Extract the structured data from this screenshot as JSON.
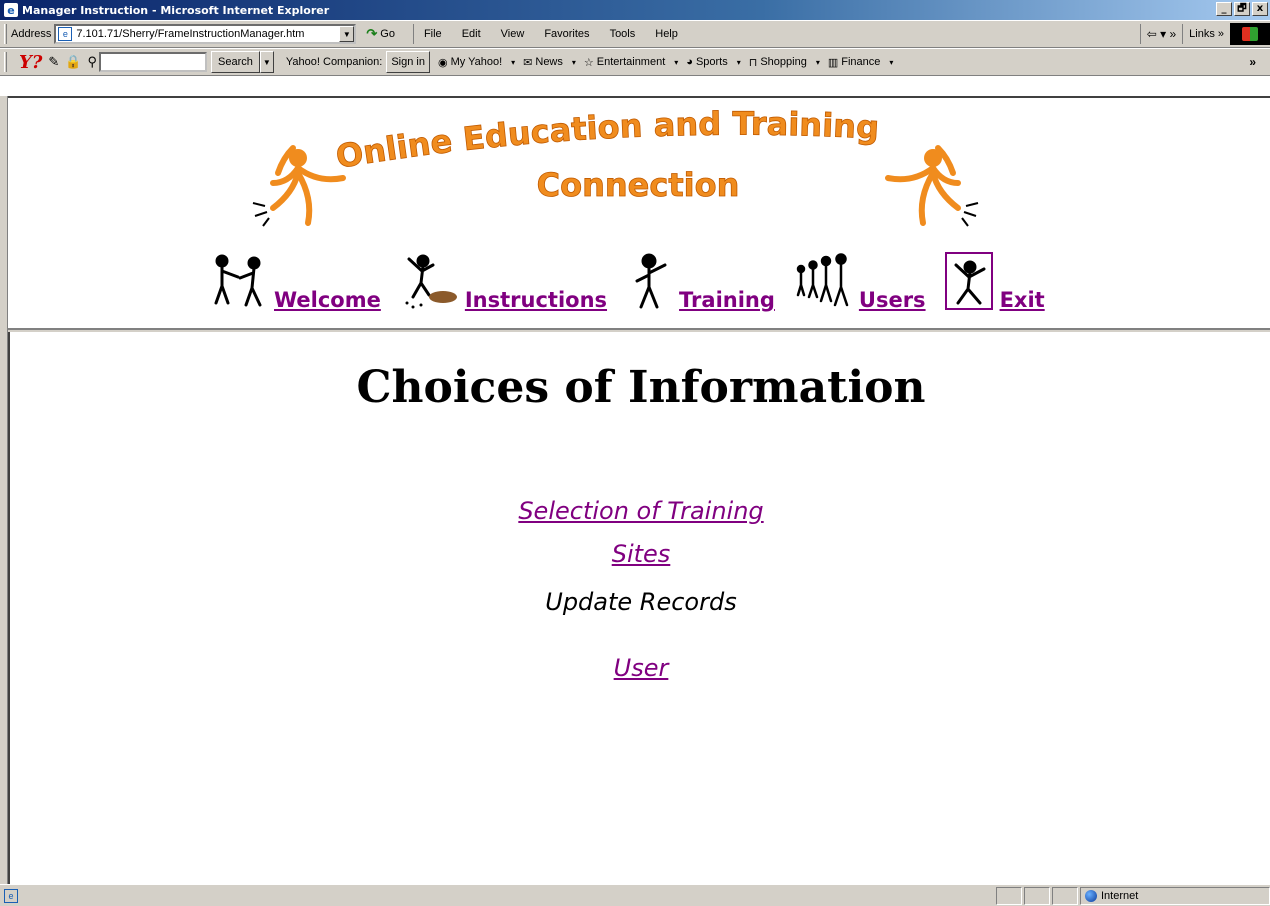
{
  "window": {
    "title": "Manager Instruction - Microsoft Internet Explorer",
    "btn_min": "_",
    "btn_max": "🗗",
    "btn_close": "x"
  },
  "address_bar": {
    "label": "Address",
    "url": "7.101.71/Sherry/FrameInstructionManager.htm",
    "go_label": "Go"
  },
  "menu": {
    "items": [
      "File",
      "Edit",
      "View",
      "Favorites",
      "Tools",
      "Help"
    ]
  },
  "toolbar_right": {
    "back_label": "⇦ ▾ »",
    "links_label": "Links »"
  },
  "yahoo_toolbar": {
    "logo": "Y?",
    "search_placeholder": "",
    "search_label": "Search",
    "companion_label": "Yahoo! Companion:",
    "signin_label": "Sign in",
    "links": [
      {
        "label": "My Yahoo!",
        "icon": "yahoo-icon"
      },
      {
        "label": "News",
        "icon": "news-icon"
      },
      {
        "label": "Entertainment",
        "icon": "star-icon"
      },
      {
        "label": "Sports",
        "icon": "ball-icon"
      },
      {
        "label": "Shopping",
        "icon": "bag-icon"
      },
      {
        "label": "Finance",
        "icon": "chart-icon"
      }
    ],
    "more": "»"
  },
  "banner": {
    "line1": "Online Education and Training",
    "line2": "Connection",
    "color": "#f08c1e"
  },
  "nav": {
    "items": [
      {
        "label": "Welcome",
        "icon": "handshake-figures-icon"
      },
      {
        "label": "Instructions",
        "icon": "digging-figure-icon"
      },
      {
        "label": "Training",
        "icon": "teacher-figure-icon"
      },
      {
        "label": "Users",
        "icon": "crowd-figures-icon"
      },
      {
        "label": "Exit",
        "icon": "exit-figure-icon"
      }
    ],
    "link_color": "#800080"
  },
  "main": {
    "heading": "Choices of Information",
    "choices": [
      {
        "label": "Selection of Training",
        "link": true
      },
      {
        "label": "Sites",
        "link": true
      },
      {
        "label": "Update Records",
        "link": false
      },
      {
        "label": "User",
        "link": true
      }
    ]
  },
  "statusbar": {
    "status_text": "",
    "zone_label": "Internet"
  }
}
